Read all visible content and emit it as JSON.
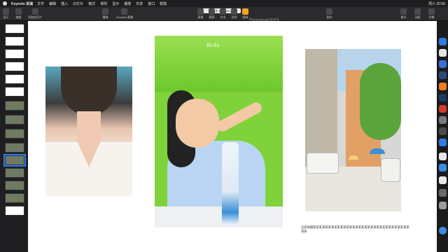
{
  "menubar": {
    "app_name": "Keynote 讲演",
    "items": [
      "文件",
      "编辑",
      "插入",
      "幻灯片",
      "格式",
      "排列",
      "显示",
      "播放",
      "共享",
      "窗口",
      "帮助"
    ],
    "clock": "周六 20:56"
  },
  "toolbar": {
    "left_items": [
      "显示",
      "缩放",
      "添加幻灯片"
    ],
    "center_items": [
      "播放",
      "Keynote 直播"
    ],
    "mid_items": [
      "表格",
      "图表",
      "文本",
      "形状",
      "媒体",
      "批注"
    ],
    "right_items": [
      "协作",
      "格式",
      "动画",
      "文稿"
    ],
    "doc_title": "未命名 2020-08-26",
    "watermark": "Photoshop/LR/PS"
  },
  "navigator": {
    "slide_count": 16,
    "selected_index": 10
  },
  "slide": {
    "photo1": {
      "subject": "woman-portrait"
    },
    "photo2": {
      "subject": "child-drinking",
      "signature": "Ri-Ss"
    },
    "photo3": {
      "subject": "street-scene"
    },
    "caption": "这是拍摄某某某某某某某某某某某某某某某某某某某某某某某某某某某某某某某某某某"
  },
  "colors": {
    "accent": "#f2a31b",
    "selection": "#2d7bf5",
    "grass": "#7fd23a"
  }
}
